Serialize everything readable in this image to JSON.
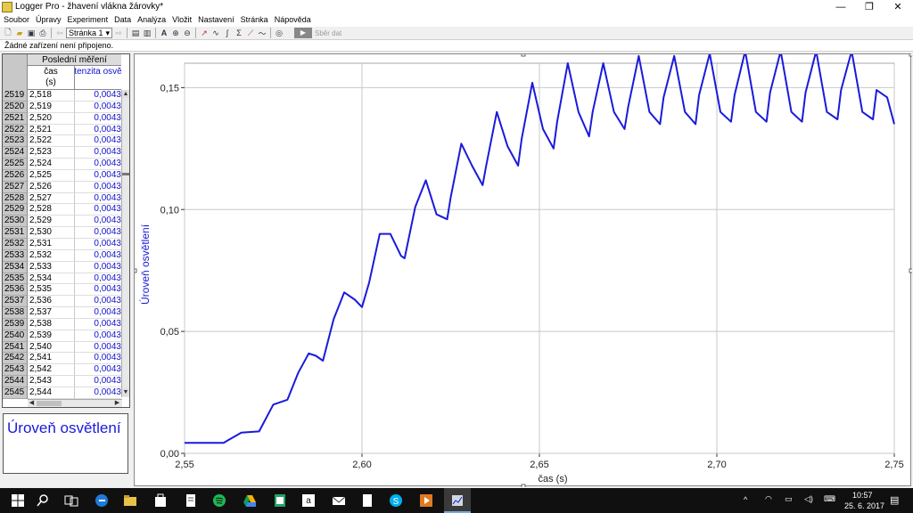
{
  "window": {
    "title": "Logger Pro - žhavení vlákna žárovky*"
  },
  "menu": [
    "Soubor",
    "Úpravy",
    "Experiment",
    "Data",
    "Analýza",
    "Vložit",
    "Nastavení",
    "Stránka",
    "Nápověda"
  ],
  "toolbar": {
    "page_select": "Stránka 1",
    "collect_label": "Sběr dat"
  },
  "status": "Žádné zařízení není připojeno.",
  "table": {
    "group_header": "Poslední měření",
    "col_time": "čas\n(s)",
    "col_time_name": "čas",
    "col_time_unit": "(s)",
    "col_intensity": "Intenzita osvětlení",
    "rows": [
      [
        "2519",
        "2,518",
        "0,0043"
      ],
      [
        "2520",
        "2,519",
        "0,0043"
      ],
      [
        "2521",
        "2,520",
        "0,0043"
      ],
      [
        "2522",
        "2,521",
        "0,0043"
      ],
      [
        "2523",
        "2,522",
        "0,0043"
      ],
      [
        "2524",
        "2,523",
        "0,0043"
      ],
      [
        "2525",
        "2,524",
        "0,0043"
      ],
      [
        "2526",
        "2,525",
        "0,0043"
      ],
      [
        "2527",
        "2,526",
        "0,0043"
      ],
      [
        "2528",
        "2,527",
        "0,0043"
      ],
      [
        "2529",
        "2,528",
        "0,0043"
      ],
      [
        "2530",
        "2,529",
        "0,0043"
      ],
      [
        "2531",
        "2,530",
        "0,0043"
      ],
      [
        "2532",
        "2,531",
        "0,0043"
      ],
      [
        "2533",
        "2,532",
        "0,0043"
      ],
      [
        "2534",
        "2,533",
        "0,0043"
      ],
      [
        "2535",
        "2,534",
        "0,0043"
      ],
      [
        "2536",
        "2,535",
        "0,0043"
      ],
      [
        "2537",
        "2,536",
        "0,0043"
      ],
      [
        "2538",
        "2,537",
        "0,0043"
      ],
      [
        "2539",
        "2,538",
        "0,0043"
      ],
      [
        "2540",
        "2,539",
        "0,0043"
      ],
      [
        "2541",
        "2,540",
        "0,0043"
      ],
      [
        "2542",
        "2,541",
        "0,0043"
      ],
      [
        "2543",
        "2,542",
        "0,0043"
      ],
      [
        "2544",
        "2,543",
        "0,0043"
      ],
      [
        "2545",
        "2,544",
        "0,0043"
      ]
    ]
  },
  "legend_text": "Úroveň osvětlení",
  "colors": {
    "series": "#1a1adc",
    "grid": "#c8c8c8"
  },
  "chart_data": {
    "type": "line",
    "xlabel": "čas (s)",
    "ylabel": "Úroveň osvětlení",
    "xlim": [
      2.55,
      2.75
    ],
    "ylim": [
      0.0,
      0.16
    ],
    "xticks": [
      "2,55",
      "2,60",
      "2,65",
      "2,70",
      "2,75"
    ],
    "yticks": [
      "0,00",
      "0,05",
      "0,10",
      "0,15"
    ],
    "grid": true,
    "series": [
      {
        "x": [
          2.55,
          2.561,
          2.563,
          2.566,
          2.571,
          2.575,
          2.579,
          2.582,
          2.585,
          2.587,
          2.589,
          2.592,
          2.595,
          2.598,
          2.6,
          2.602,
          2.605,
          2.608,
          2.611,
          2.612,
          2.615,
          2.618,
          2.621,
          2.624,
          2.625,
          2.628,
          2.631,
          2.634,
          2.635,
          2.638,
          2.641,
          2.644,
          2.645,
          2.648,
          2.651,
          2.654,
          2.655,
          2.658,
          2.661,
          2.664,
          2.665,
          2.668,
          2.671,
          2.674,
          2.675,
          2.678,
          2.681,
          2.684,
          2.685,
          2.688,
          2.691,
          2.694,
          2.695,
          2.698,
          2.701,
          2.704,
          2.705,
          2.708,
          2.711,
          2.714,
          2.715,
          2.718,
          2.721,
          2.724,
          2.725,
          2.728,
          2.731,
          2.734,
          2.735,
          2.738,
          2.741,
          2.744,
          2.745,
          2.748,
          2.75
        ],
        "y": [
          0.0043,
          0.0043,
          0.006,
          0.0085,
          0.009,
          0.02,
          0.022,
          0.033,
          0.041,
          0.04,
          0.038,
          0.055,
          0.066,
          0.063,
          0.06,
          0.07,
          0.09,
          0.09,
          0.081,
          0.08,
          0.101,
          0.112,
          0.098,
          0.096,
          0.105,
          0.127,
          0.118,
          0.11,
          0.118,
          0.14,
          0.126,
          0.118,
          0.129,
          0.152,
          0.133,
          0.125,
          0.136,
          0.16,
          0.14,
          0.13,
          0.14,
          0.16,
          0.14,
          0.133,
          0.142,
          0.163,
          0.14,
          0.135,
          0.146,
          0.163,
          0.14,
          0.135,
          0.147,
          0.164,
          0.14,
          0.136,
          0.147,
          0.165,
          0.14,
          0.136,
          0.148,
          0.165,
          0.14,
          0.136,
          0.148,
          0.165,
          0.14,
          0.137,
          0.149,
          0.165,
          0.14,
          0.137,
          0.149,
          0.146,
          0.135
        ]
      }
    ]
  },
  "taskbar": {
    "time": "10:57",
    "date": "25. 6. 2017"
  }
}
